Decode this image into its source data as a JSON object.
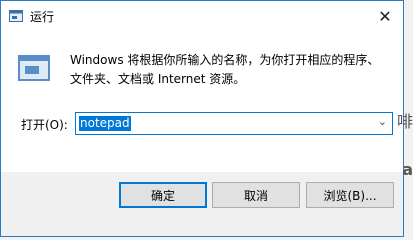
{
  "window": {
    "title": "运行",
    "close_glyph": "✕"
  },
  "dialog": {
    "description_line1": "Windows 将根据你所输入的名称，为你打开相应的程序、",
    "description_line2": "文件夹、文档或 Internet 资源。",
    "open_label": "打开(O):",
    "input_value": "notepad",
    "dropdown_glyph": "⌄"
  },
  "buttons": {
    "ok": "确定",
    "cancel": "取消",
    "browse": "浏览(B)..."
  },
  "background": {
    "edge_glyph_1": "啡",
    "edge_glyph_2": "a"
  },
  "colors": {
    "accent": "#0078d7",
    "footer_bg": "#f0f0f0"
  },
  "icons": {
    "title_icon": "run-app-icon",
    "dialog_icon": "run-dialog-icon"
  }
}
